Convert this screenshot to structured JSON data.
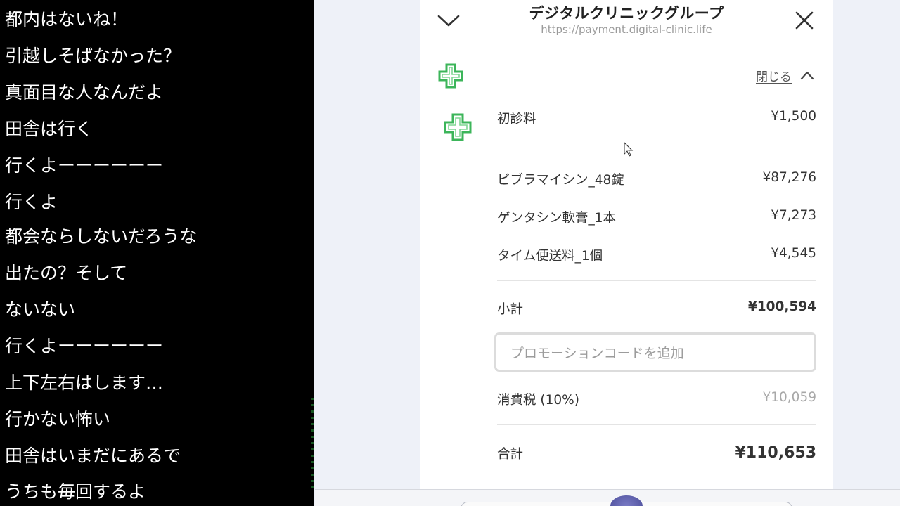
{
  "comments": [
    "都内はないね！",
    "引越しそばなかった？",
    "真面目な人なんだよ",
    "田舎は行く",
    "行くよーーーーーー",
    "行くよ",
    "都会ならしないだろうな",
    "出たの？そして",
    "ないない",
    "行くよーーーーーー",
    "上下左右はします…",
    "行かない怖い",
    "田舎はいまだにあるで",
    "うちも毎回するよ"
  ],
  "header": {
    "title": "デジタルクリニックグループ",
    "url": "https://payment.digital-clinic.life"
  },
  "summary": {
    "collapse_label": "閉じる",
    "items": [
      {
        "name": "初診料",
        "amount": "¥1,500"
      },
      {
        "name": "ビブラマイシン_48錠",
        "amount": "¥87,276"
      },
      {
        "name": "ゲンタシン軟膏_1本",
        "amount": "¥7,273"
      },
      {
        "name": "タイム便送料_1個",
        "amount": "¥4,545"
      }
    ],
    "subtotal_label": "小計",
    "subtotal_amount": "¥100,594",
    "promo_placeholder": "プロモーションコードを追加",
    "tax_label": "消費税 (10%)",
    "tax_amount": "¥10,059",
    "total_label": "合計",
    "total_amount": "¥110,653"
  },
  "colors": {
    "brand_green": "#3cb55a",
    "comment_bg": "#000000",
    "backdrop": "#eef1f8"
  }
}
